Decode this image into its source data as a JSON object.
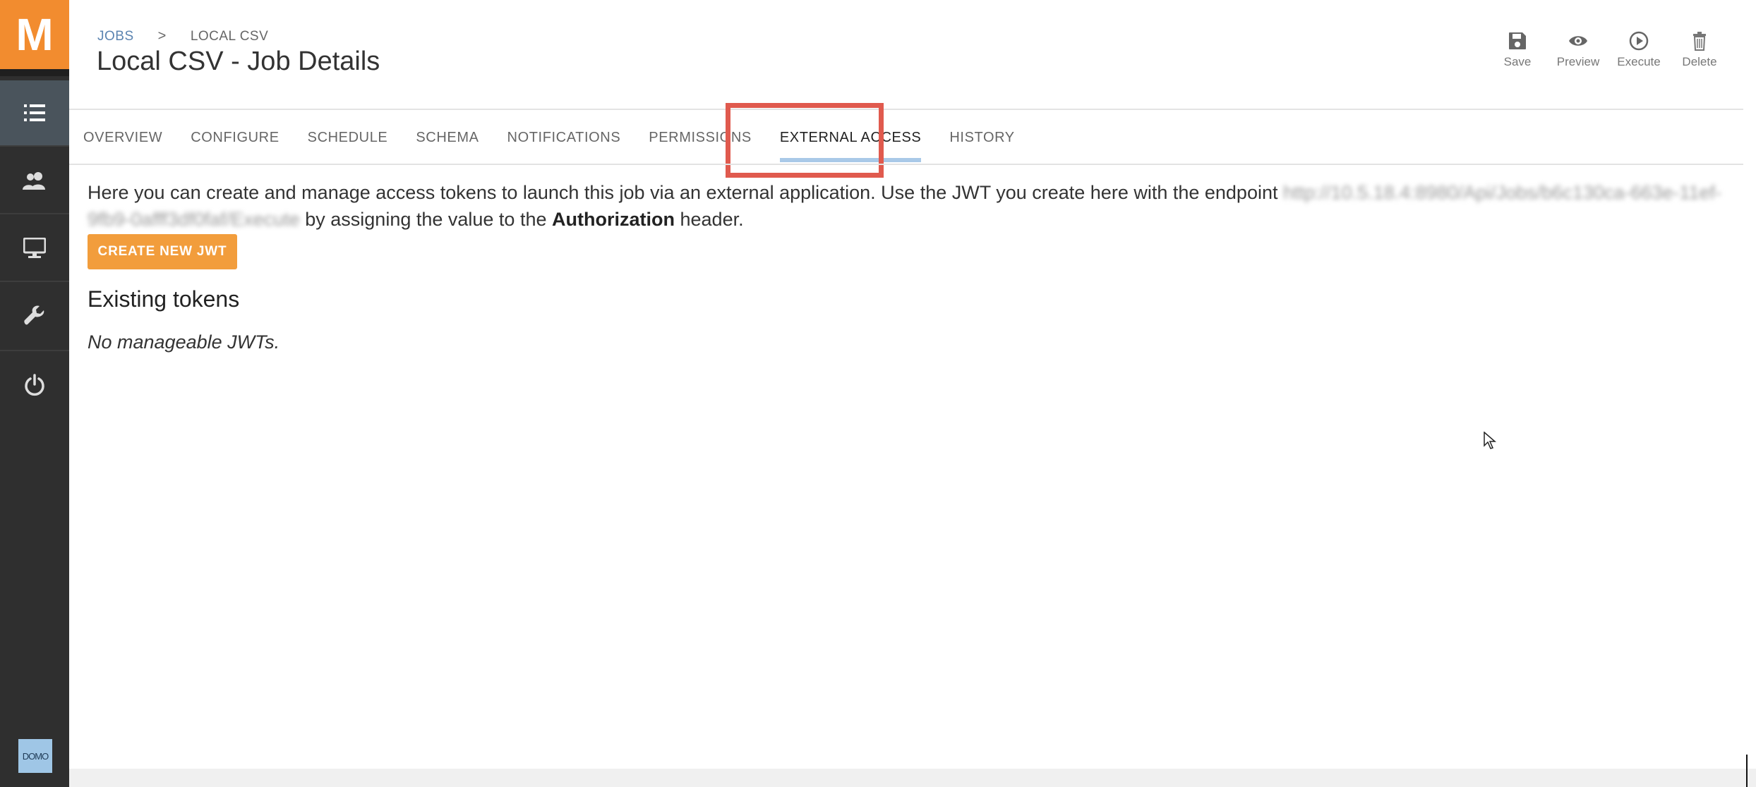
{
  "app": {
    "logo_letter": "M",
    "accent_color": "#f28c2f",
    "footer_badge": "DOMO"
  },
  "sidebar": {
    "items": [
      {
        "icon": "list-icon",
        "active": true
      },
      {
        "icon": "users-icon",
        "active": false
      },
      {
        "icon": "monitor-icon",
        "active": false
      },
      {
        "icon": "wrench-icon",
        "active": false
      },
      {
        "icon": "power-icon",
        "active": false
      }
    ]
  },
  "header": {
    "breadcrumb": {
      "root": "JOBS",
      "separator": ">",
      "current": "LOCAL CSV"
    },
    "title": "Local CSV - Job Details",
    "actions": [
      {
        "label": "Save",
        "icon": "save-icon"
      },
      {
        "label": "Preview",
        "icon": "eye-icon"
      },
      {
        "label": "Execute",
        "icon": "play-circle-icon"
      },
      {
        "label": "Delete",
        "icon": "trash-icon"
      }
    ]
  },
  "tabs": [
    {
      "label": "OVERVIEW"
    },
    {
      "label": "CONFIGURE"
    },
    {
      "label": "SCHEDULE"
    },
    {
      "label": "SCHEMA"
    },
    {
      "label": "NOTIFICATIONS"
    },
    {
      "label": "PERMISSIONS"
    },
    {
      "label": "EXTERNAL ACCESS",
      "active": true
    },
    {
      "label": "HISTORY"
    }
  ],
  "external_access": {
    "intro_before": "Here you can create and manage access tokens to launch this job via an external application. Use the JWT you create here with the endpoint",
    "endpoint": "http://10.5.18.4:8980/Api/Jobs/b6c130ca-663e-11ef-9fb9-0afff3df0faf/Execute",
    "intro_middle": "by assigning the value to the",
    "header_name": "Authorization",
    "intro_after": "header.",
    "create_button": "CREATE NEW JWT",
    "existing_title": "Existing tokens",
    "empty_message": "No manageable JWTs."
  },
  "colors": {
    "sidebar_bg": "#2f2f2f",
    "button_bg": "#f29d3c",
    "highlight_box": "#e05a4e",
    "tab_underline": "#a9c9e8",
    "link": "#5b84b1"
  }
}
